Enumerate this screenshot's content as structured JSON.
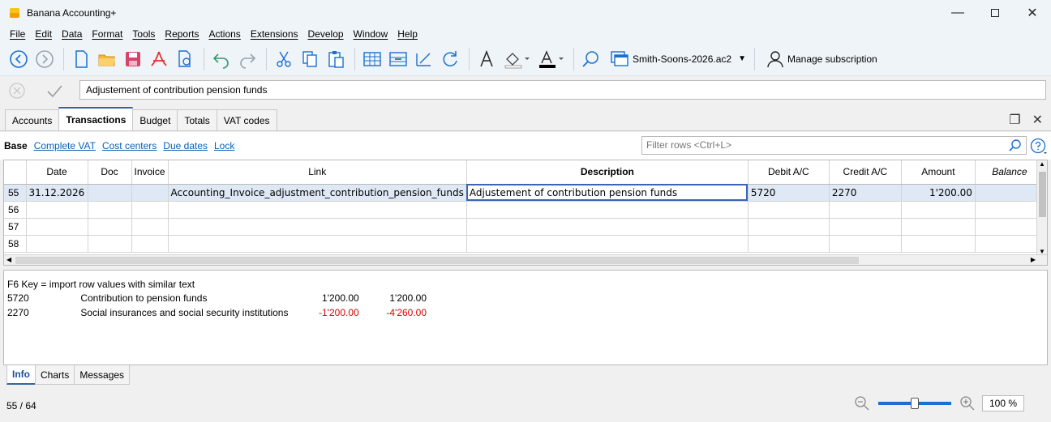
{
  "window": {
    "title": "Banana Accounting+"
  },
  "menu": [
    "File",
    "Edit",
    "Data",
    "Format",
    "Tools",
    "Reports",
    "Actions",
    "Extensions",
    "Develop",
    "Window",
    "Help"
  ],
  "toolbar": {
    "file_name": "Smith-Soons-2026.ac2",
    "subscription_label": "Manage subscription"
  },
  "edit_bar": {
    "value": "Adjustement of contribution pension funds"
  },
  "tabs": [
    "Accounts",
    "Transactions",
    "Budget",
    "Totals",
    "VAT codes"
  ],
  "active_tab": "Transactions",
  "views": [
    "Base",
    "Complete VAT",
    "Cost centers",
    "Due dates",
    "Lock"
  ],
  "filter": {
    "placeholder": "Filter rows <Ctrl+L>"
  },
  "grid": {
    "columns": [
      "",
      "Date",
      "Doc",
      "Invoice",
      "Link",
      "Description",
      "Debit A/C",
      "Credit A/C",
      "Amount",
      "Balance"
    ],
    "rows": [
      {
        "rn": "55",
        "date": "31.12.2026",
        "doc": "",
        "invoice": "",
        "link": "Accounting_Invoice_adjustment_contribution_pension_funds",
        "description": "Adjustement of contribution pension funds",
        "debit": "5720",
        "credit": "2270",
        "amount": "1'200.00",
        "balance": ""
      },
      {
        "rn": "56",
        "date": "",
        "doc": "",
        "invoice": "",
        "link": "",
        "description": "",
        "debit": "",
        "credit": "",
        "amount": "",
        "balance": ""
      },
      {
        "rn": "57",
        "date": "",
        "doc": "",
        "invoice": "",
        "link": "",
        "description": "",
        "debit": "",
        "credit": "",
        "amount": "",
        "balance": ""
      },
      {
        "rn": "58",
        "date": "",
        "doc": "",
        "invoice": "",
        "link": "",
        "description": "",
        "debit": "",
        "credit": "",
        "amount": "",
        "balance": ""
      }
    ]
  },
  "info": {
    "hint": "F6 Key = import row values with similar text",
    "lines": [
      {
        "account": "5720",
        "description": "Contribution to pension funds",
        "amount": "1'200.00",
        "balance": "1'200.00",
        "negative": false
      },
      {
        "account": "2270",
        "description": "Social insurances and social security institutions",
        "amount": "-1'200.00",
        "balance": "-4'260.00",
        "negative": true
      }
    ]
  },
  "bottom_tabs": [
    "Info",
    "Charts",
    "Messages"
  ],
  "status": {
    "position": "55 / 64",
    "zoom": "100 %",
    "zoom_fraction": 0.5
  },
  "colors": {
    "accent": "#3465a4",
    "link": "#0b5fb5",
    "negative": "#e00000"
  }
}
